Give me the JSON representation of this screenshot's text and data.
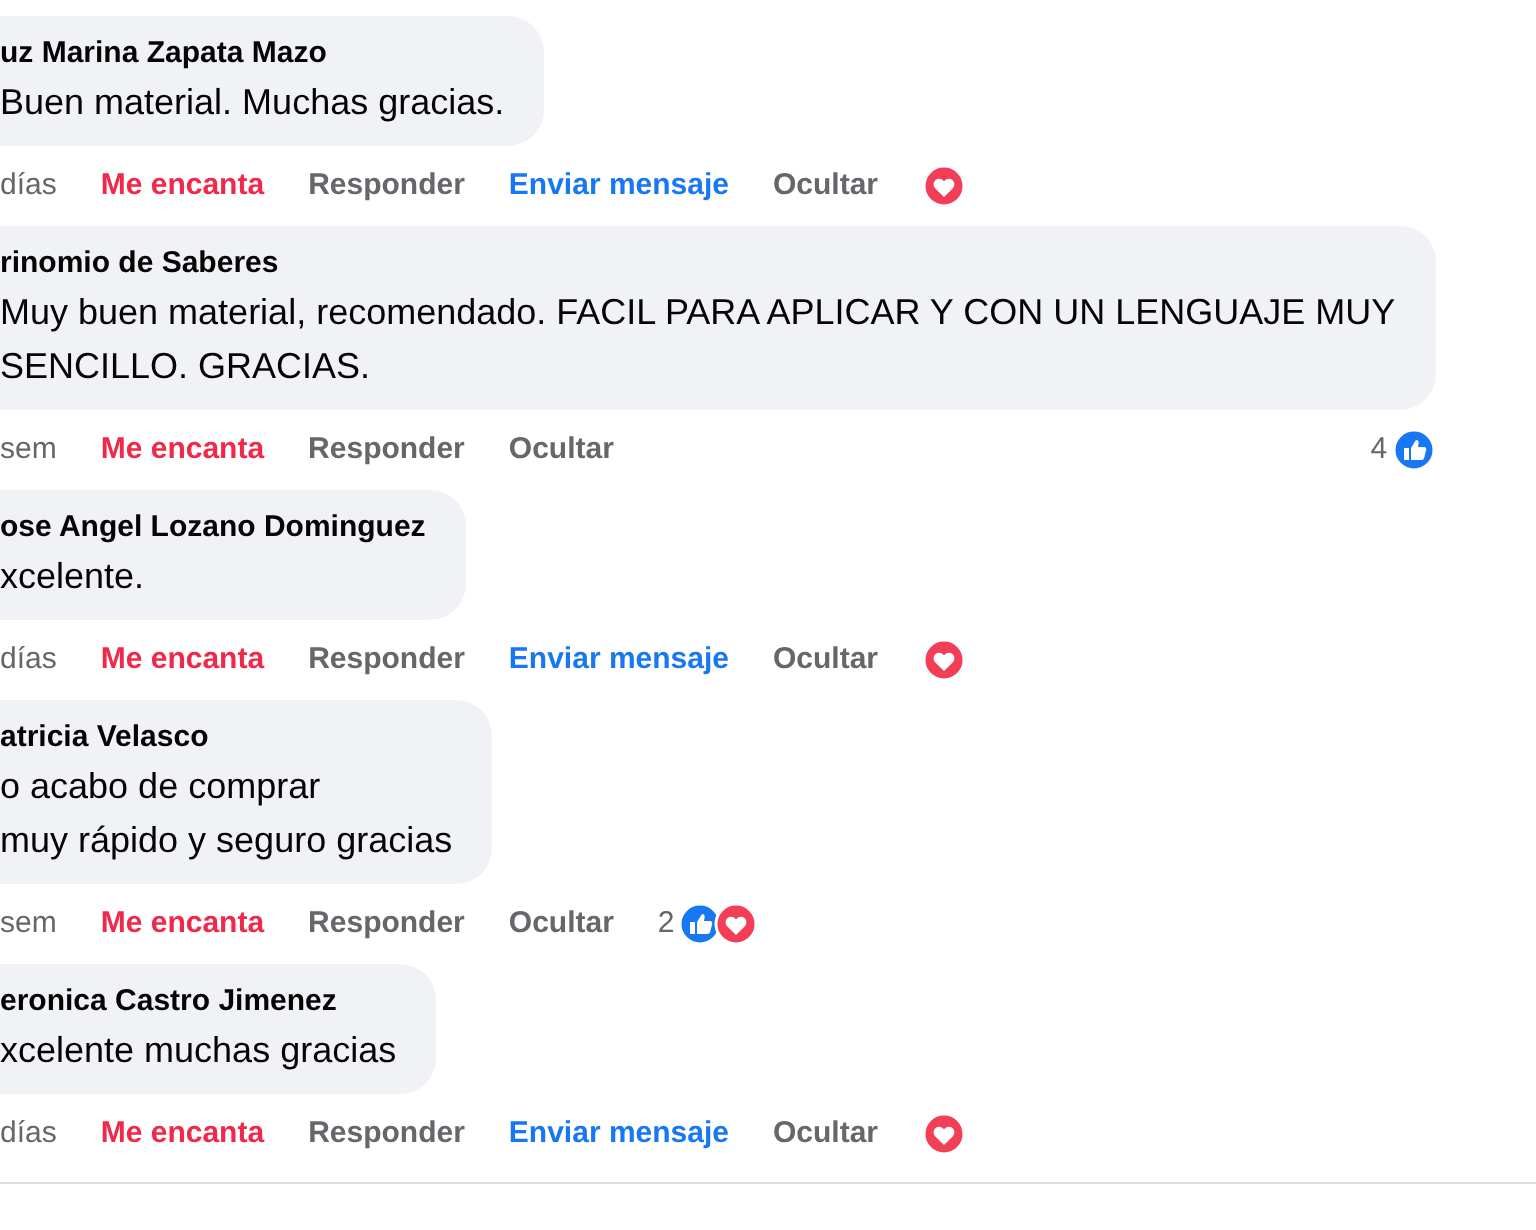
{
  "comments": [
    {
      "author": "uz Marina Zapata Mazo",
      "lines": [
        "Buen material. Muchas gracias."
      ],
      "time": "días",
      "actions": [
        {
          "kind": "love",
          "label": "Me encanta",
          "selected": true
        },
        {
          "kind": "plain",
          "label": "Responder"
        },
        {
          "kind": "message",
          "label": "Enviar mensaje"
        },
        {
          "kind": "plain",
          "label": "Ocultar"
        }
      ],
      "reactions": {
        "icons": [
          {
            "kind": "love"
          }
        ]
      }
    },
    {
      "author": "rinomio de Saberes",
      "lines": [
        "Muy buen material, recomendado. FACIL PARA APLICAR Y CON UN LENGUAJE MUY",
        "SENCILLO. GRACIAS."
      ],
      "time": "sem",
      "actions": [
        {
          "kind": "love",
          "label": "Me encanta",
          "selected": true
        },
        {
          "kind": "plain",
          "label": "Responder"
        },
        {
          "kind": "plain",
          "label": "Ocultar"
        }
      ],
      "reactions": {
        "count": "4",
        "icons": [
          {
            "kind": "like"
          }
        ]
      }
    },
    {
      "author": "ose Angel Lozano Dominguez",
      "lines": [
        "xcelente."
      ],
      "time": "días",
      "actions": [
        {
          "kind": "love",
          "label": "Me encanta",
          "selected": true
        },
        {
          "kind": "plain",
          "label": "Responder"
        },
        {
          "kind": "message",
          "label": "Enviar mensaje"
        },
        {
          "kind": "plain",
          "label": "Ocultar"
        }
      ],
      "reactions": {
        "icons": [
          {
            "kind": "love"
          }
        ]
      }
    },
    {
      "author": "atricia Velasco",
      "lines": [
        "o acabo de comprar",
        "muy rápido y seguro gracias"
      ],
      "time": "sem",
      "actions": [
        {
          "kind": "love",
          "label": "Me encanta",
          "selected": true
        },
        {
          "kind": "plain",
          "label": "Responder"
        },
        {
          "kind": "plain",
          "label": "Ocultar"
        }
      ],
      "reactions": {
        "count": "2",
        "icons": [
          {
            "kind": "like"
          },
          {
            "kind": "love"
          }
        ]
      }
    },
    {
      "author": "eronica Castro Jimenez",
      "lines": [
        "xcelente muchas gracias"
      ],
      "time": "días",
      "actions": [
        {
          "kind": "love",
          "label": "Me encanta",
          "selected": true
        },
        {
          "kind": "plain",
          "label": "Responder"
        },
        {
          "kind": "message",
          "label": "Enviar mensaje"
        },
        {
          "kind": "plain",
          "label": "Ocultar"
        }
      ],
      "reactions": {
        "icons": [
          {
            "kind": "love"
          }
        ]
      }
    }
  ]
}
